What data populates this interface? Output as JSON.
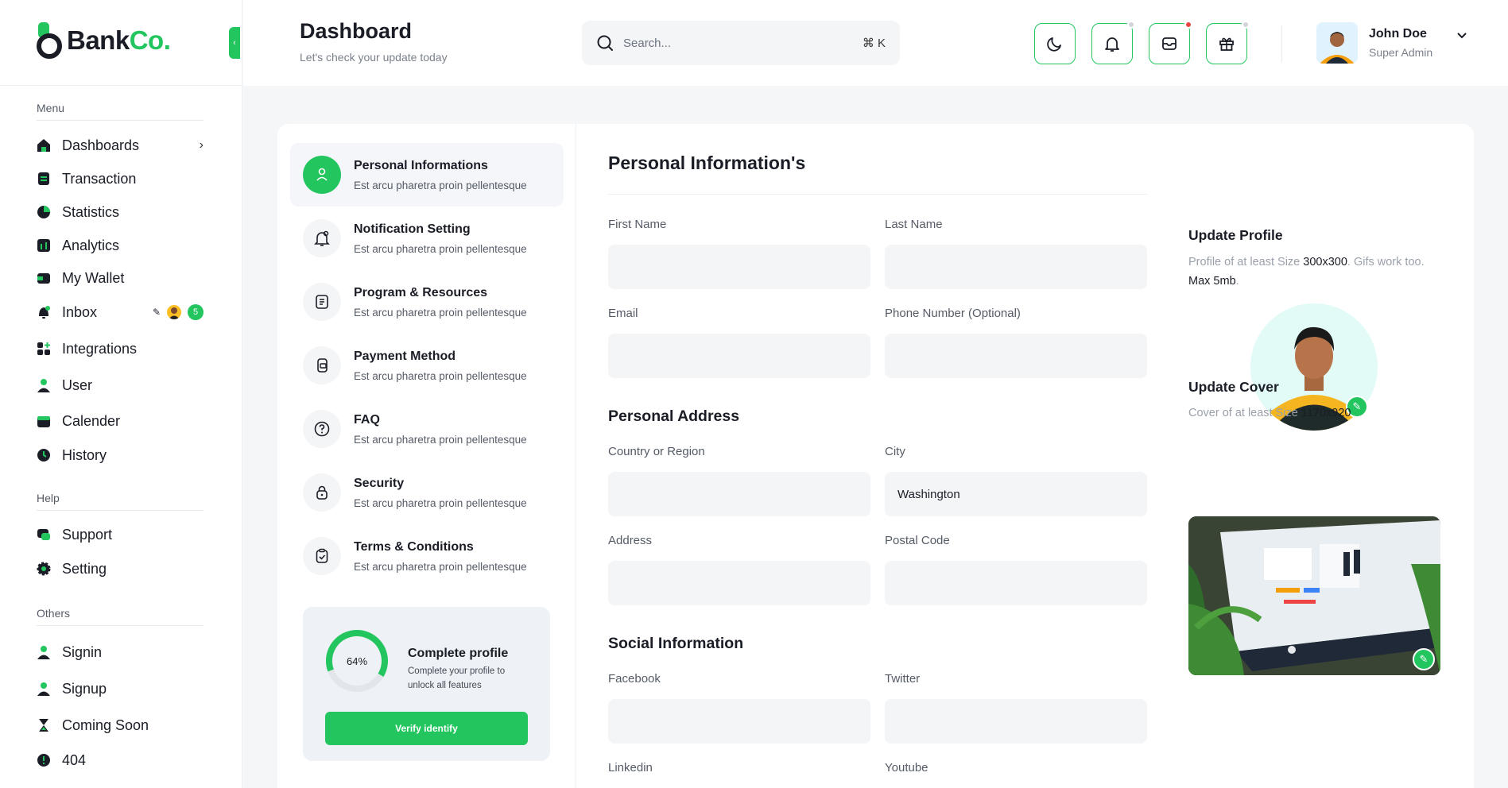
{
  "brand": {
    "name_part1": "Bank",
    "name_part2": "Co.",
    "accent": "#22c55e"
  },
  "sidebar": {
    "sections": [
      {
        "title": "Menu"
      },
      {
        "title": "Help"
      },
      {
        "title": "Others"
      }
    ],
    "menu": [
      {
        "label": "Dashboards",
        "icon": "home-icon"
      },
      {
        "label": "Transaction",
        "icon": "receipt-icon"
      },
      {
        "label": "Statistics",
        "icon": "pie-chart-icon"
      },
      {
        "label": "Analytics",
        "icon": "bar-chart-icon"
      },
      {
        "label": "My Wallet",
        "icon": "wallet-icon"
      },
      {
        "label": "Inbox",
        "icon": "bell-icon",
        "badge": "5"
      },
      {
        "label": "Integrations",
        "icon": "grid-plus-icon"
      },
      {
        "label": "User",
        "icon": "user-icon"
      },
      {
        "label": "Calender",
        "icon": "calendar-icon"
      },
      {
        "label": "History",
        "icon": "clock-icon"
      }
    ],
    "help": [
      {
        "label": "Support",
        "icon": "chat-icon"
      },
      {
        "label": "Setting",
        "icon": "gear-icon"
      }
    ],
    "others": [
      {
        "label": "Signin",
        "icon": "user-icon"
      },
      {
        "label": "Signup",
        "icon": "user-icon"
      },
      {
        "label": "Coming Soon",
        "icon": "hourglass-icon"
      },
      {
        "label": "404",
        "icon": "alert-icon"
      }
    ]
  },
  "header": {
    "title": "Dashboard",
    "subtitle": "Let's check your update today",
    "search": {
      "placeholder": "Search...",
      "shortcut": "⌘ K"
    },
    "user": {
      "name": "John Doe",
      "role": "Super Admin"
    }
  },
  "settings_menu": [
    {
      "title": "Personal Informations",
      "desc": "Est arcu pharetra proin pellentesque",
      "icon": "user-icon",
      "active": true
    },
    {
      "title": "Notification Setting",
      "desc": "Est arcu pharetra proin pellentesque",
      "icon": "bell-icon"
    },
    {
      "title": "Program & Resources",
      "desc": "Est arcu pharetra proin pellentesque",
      "icon": "document-icon"
    },
    {
      "title": "Payment Method",
      "desc": "Est arcu pharetra proin pellentesque",
      "icon": "card-icon"
    },
    {
      "title": "FAQ",
      "desc": "Est arcu pharetra proin pellentesque",
      "icon": "question-icon"
    },
    {
      "title": "Security",
      "desc": "Est arcu pharetra proin pellentesque",
      "icon": "lock-icon"
    },
    {
      "title": "Terms & Conditions",
      "desc": "Est arcu pharetra proin pellentesque",
      "icon": "clipboard-check-icon"
    }
  ],
  "complete_profile": {
    "percent_label": "64%",
    "percent": 64,
    "title": "Complete profile",
    "desc": "Complete your profile to unlock all features",
    "button": "Verify identify"
  },
  "form": {
    "title": "Personal Information's",
    "first_name": {
      "label": "First Name",
      "value": ""
    },
    "last_name": {
      "label": "Last Name",
      "value": ""
    },
    "email": {
      "label": "Email",
      "value": ""
    },
    "phone": {
      "label": "Phone Number (Optional)",
      "value": ""
    },
    "address_section": "Personal Address",
    "country": {
      "label": "Country or Region",
      "value": ""
    },
    "city": {
      "label": "City",
      "value": "Washington"
    },
    "address": {
      "label": "Address",
      "value": ""
    },
    "postal": {
      "label": "Postal Code",
      "value": ""
    },
    "social_section": "Social Information",
    "facebook": {
      "label": "Facebook",
      "value": ""
    },
    "twitter": {
      "label": "Twitter",
      "value": ""
    },
    "linkedin": {
      "label": "Linkedin"
    },
    "youtube": {
      "label": "Youtube"
    }
  },
  "update_profile": {
    "title": "Update Profile",
    "desc_a": "Profile of at least Size ",
    "desc_b": "300x300",
    "desc_c": ". Gifs work too. ",
    "desc_d": "Max 5mb",
    "desc_e": "."
  },
  "update_cover": {
    "title": "Update Cover",
    "desc_a": "Cover of at least Size ",
    "desc_b": "1170x920"
  }
}
